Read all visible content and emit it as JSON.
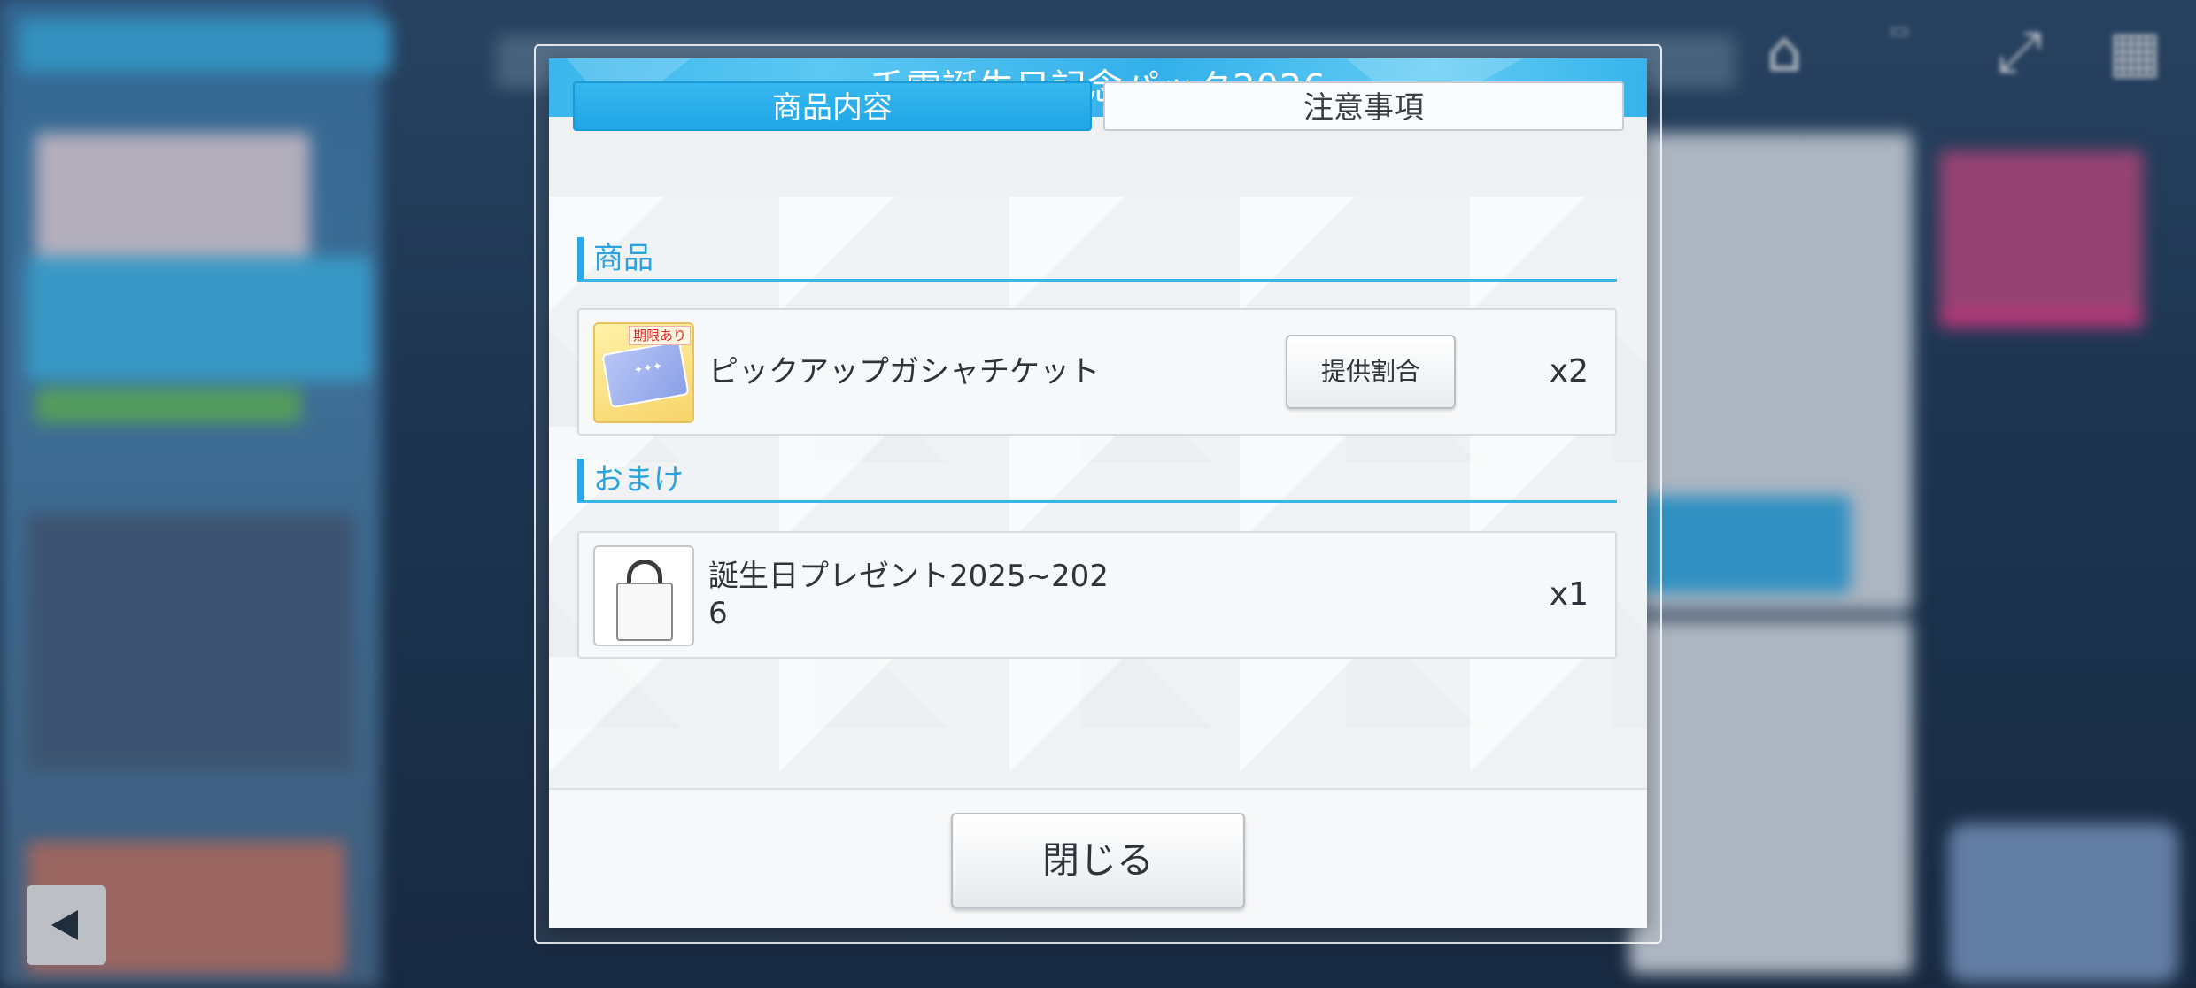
{
  "dialog": {
    "title": "千雪誕生日記念パック2026",
    "tabs": [
      {
        "label": "商品内容",
        "active": true
      },
      {
        "label": "注意事項",
        "active": false
      }
    ],
    "sections": [
      {
        "title": "商品",
        "items": [
          {
            "name": "ピックアップガシャチケット",
            "badge": "期限あり",
            "icon": "pickup-gasha-ticket-icon",
            "button_label": "提供割合",
            "quantity": "x2"
          }
        ]
      },
      {
        "title": "おまけ",
        "items": [
          {
            "name": "誕生日プレゼント2025~2026",
            "icon": "birthday-present-bag-icon",
            "quantity": "x1"
          }
        ]
      }
    ],
    "close_label": "閉じる"
  },
  "background": {
    "top_icons": [
      "home-icon",
      "display-icon",
      "fullscreen-icon",
      "menu-grid-icon"
    ]
  },
  "colors": {
    "accent": "#2aa9e6",
    "header": "#39b6ec",
    "panel": "#f6f7f8",
    "text": "#2f343b"
  }
}
